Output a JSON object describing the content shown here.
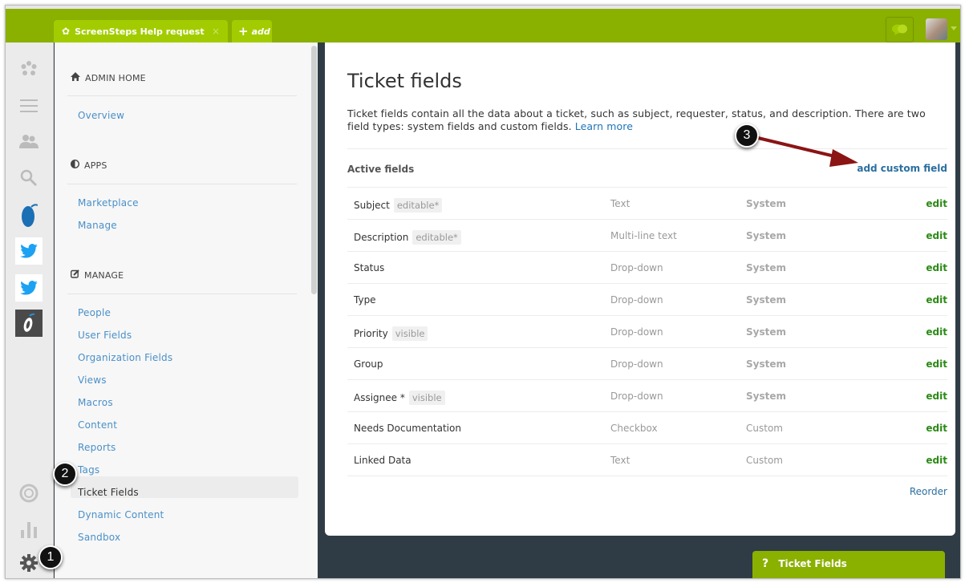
{
  "topbar": {
    "tab_title": "ScreenSteps Help request",
    "tab_close": "×",
    "add_tab_label": "add",
    "add_tab_plus": "+"
  },
  "rail": {
    "icons": [
      "zendesk-logo-icon",
      "menu-icon",
      "users-icon",
      "search-icon",
      "app-droplet-icon",
      "twitter-icon",
      "twitter-icon",
      "app-o-icon",
      "support-lifebuoy-icon",
      "reports-bar-icon",
      "admin-gear-icon"
    ]
  },
  "sidebar": {
    "admin_home": "ADMIN HOME",
    "admin_links": [
      "Overview"
    ],
    "apps": "APPS",
    "apps_links": [
      "Marketplace",
      "Manage"
    ],
    "manage": "MANAGE",
    "manage_links": [
      "People",
      "User Fields",
      "Organization Fields",
      "Views",
      "Macros",
      "Content",
      "Reports",
      "Tags",
      "Ticket Fields",
      "Dynamic Content",
      "Sandbox"
    ],
    "active_item": "Ticket Fields"
  },
  "main": {
    "title": "Ticket fields",
    "description": "Ticket fields contain all the data about a ticket, such as subject, requester, status, and description. There are two field types: system fields and custom fields.",
    "learn_more": "Learn more",
    "active_fields_label": "Active fields",
    "add_custom_field": "add custom field",
    "edit_label": "edit",
    "reorder": "Reorder",
    "fields": [
      {
        "name": "Subject",
        "badge": "editable*",
        "type": "Text",
        "kind": "System"
      },
      {
        "name": "Description",
        "badge": "editable*",
        "type": "Multi-line text",
        "kind": "System"
      },
      {
        "name": "Status",
        "badge": "",
        "type": "Drop-down",
        "kind": "System"
      },
      {
        "name": "Type",
        "badge": "",
        "type": "Drop-down",
        "kind": "System"
      },
      {
        "name": "Priority",
        "badge": "visible",
        "type": "Drop-down",
        "kind": "System"
      },
      {
        "name": "Group",
        "badge": "",
        "type": "Drop-down",
        "kind": "System"
      },
      {
        "name": "Assignee *",
        "badge": "visible",
        "type": "Drop-down",
        "kind": "System"
      },
      {
        "name": "Needs Documentation",
        "badge": "",
        "type": "Checkbox",
        "kind": "Custom"
      },
      {
        "name": "Linked Data",
        "badge": "",
        "type": "Text",
        "kind": "Custom"
      }
    ]
  },
  "help_widget": {
    "icon": "?",
    "label": "Ticket Fields"
  },
  "callouts": [
    "1",
    "2",
    "3"
  ],
  "colors": {
    "brand_green": "#8ab000",
    "tab_green": "#a3cc00",
    "link_blue": "#4a90c8",
    "edit_green": "#2b8a15",
    "arrow_red": "#8b1414"
  }
}
